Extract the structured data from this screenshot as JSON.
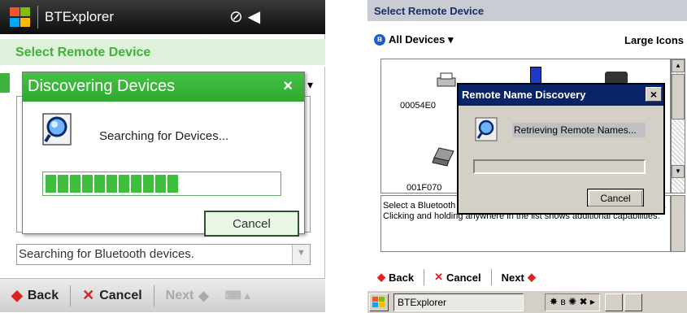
{
  "left_device": {
    "app_title": "BTExplorer",
    "status_icons": "⊘◀",
    "header": "Select Remote Device",
    "dialog": {
      "title": "Discovering Devices",
      "close": "×",
      "message": "Searching for Devices...",
      "progress": 0.55,
      "cancel_label": "Cancel"
    },
    "status_text": "Searching for Bluetooth devices.",
    "bottom_bar": {
      "back": "Back",
      "cancel": "Cancel",
      "next": "Next"
    },
    "colors": {
      "accent": "#3db23d",
      "title_bar": "#1a1a1a"
    }
  },
  "right_device": {
    "header": "Select Remote Device",
    "filter": "All Devices ▾",
    "view_mode": "Large Icons",
    "device_labels": [
      "00054E0",
      "001F070"
    ],
    "help_text": "Select a Bluetooth device. The devices can be filtered using the toolbar. Clicking and holding anywhere in the list shows additional capabilities.",
    "dialog": {
      "title": "Remote Name Discovery",
      "close": "×",
      "message": "Retrieving Remote Names...",
      "cancel_label": "Cancel"
    },
    "command_bar": {
      "back": "Back",
      "cancel": "Cancel",
      "next": "Next"
    },
    "taskbar_app": "BTExplorer",
    "colors": {
      "dialog_title": "#0a246a",
      "face": "#d4d0c8"
    }
  }
}
